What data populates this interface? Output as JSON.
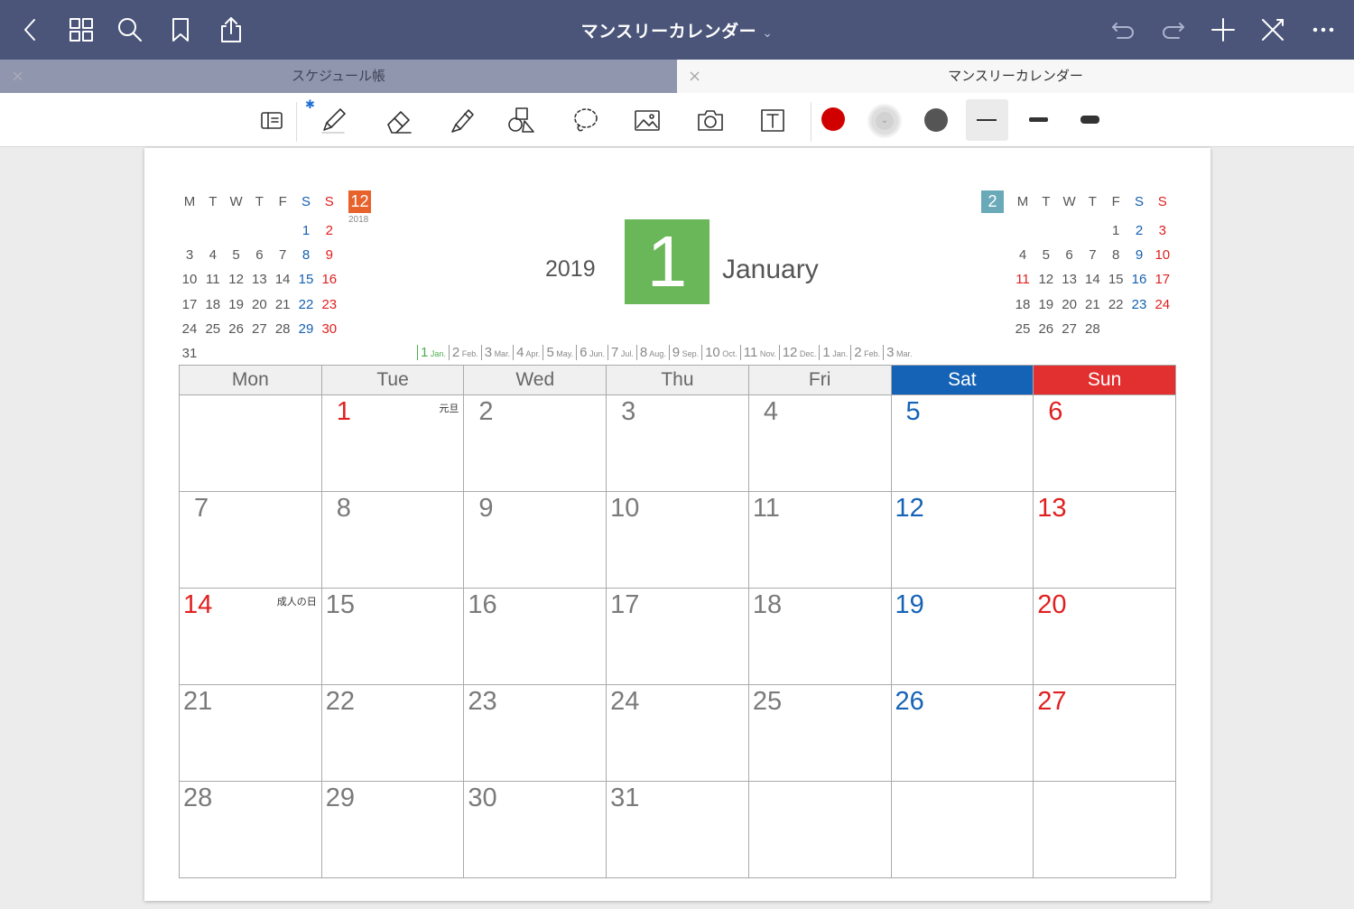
{
  "app": {
    "document_title": "マンスリーカレンダー",
    "title_chevron": "⌄"
  },
  "tabs": [
    {
      "label": "スケジュール帳",
      "close": "×"
    },
    {
      "label": "マンスリーカレンダー",
      "close": "×"
    }
  ],
  "toolbar": {
    "pen_color": "#cc0000",
    "selected_color": "#dcdcdc",
    "gray_color": "#555555",
    "bluetooth": "✱"
  },
  "calendar": {
    "year": "2019",
    "month_number": "1",
    "month_name": "January",
    "weekdays": [
      "Mon",
      "Tue",
      "Wed",
      "Thu",
      "Fri",
      "Sat",
      "Sun"
    ],
    "weeks": [
      [
        {
          "d": "",
          "h": ""
        },
        {
          "d": "1",
          "h": "元旦",
          "sun": true
        },
        {
          "d": "2",
          "h": ""
        },
        {
          "d": "3",
          "h": ""
        },
        {
          "d": "4",
          "h": ""
        },
        {
          "d": "5",
          "h": ""
        },
        {
          "d": "6",
          "h": ""
        }
      ],
      [
        {
          "d": "7",
          "h": ""
        },
        {
          "d": "8",
          "h": ""
        },
        {
          "d": "9",
          "h": ""
        },
        {
          "d": "10",
          "h": ""
        },
        {
          "d": "11",
          "h": ""
        },
        {
          "d": "12",
          "h": ""
        },
        {
          "d": "13",
          "h": ""
        }
      ],
      [
        {
          "d": "14",
          "h": "成人の日",
          "sun": true
        },
        {
          "d": "15",
          "h": ""
        },
        {
          "d": "16",
          "h": ""
        },
        {
          "d": "17",
          "h": ""
        },
        {
          "d": "18",
          "h": ""
        },
        {
          "d": "19",
          "h": ""
        },
        {
          "d": "20",
          "h": ""
        }
      ],
      [
        {
          "d": "21",
          "h": ""
        },
        {
          "d": "22",
          "h": ""
        },
        {
          "d": "23",
          "h": ""
        },
        {
          "d": "24",
          "h": ""
        },
        {
          "d": "25",
          "h": ""
        },
        {
          "d": "26",
          "h": ""
        },
        {
          "d": "27",
          "h": ""
        }
      ],
      [
        {
          "d": "28",
          "h": ""
        },
        {
          "d": "29",
          "h": ""
        },
        {
          "d": "30",
          "h": ""
        },
        {
          "d": "31",
          "h": ""
        },
        {
          "d": "",
          "h": ""
        },
        {
          "d": "",
          "h": ""
        },
        {
          "d": "",
          "h": ""
        }
      ]
    ],
    "month_nav": [
      {
        "n": "1",
        "abbr": "Jan."
      },
      {
        "n": "2",
        "abbr": "Feb."
      },
      {
        "n": "3",
        "abbr": "Mar."
      },
      {
        "n": "4",
        "abbr": "Apr."
      },
      {
        "n": "5",
        "abbr": "May."
      },
      {
        "n": "6",
        "abbr": "Jun."
      },
      {
        "n": "7",
        "abbr": "Jul."
      },
      {
        "n": "8",
        "abbr": "Aug."
      },
      {
        "n": "9",
        "abbr": "Sep."
      },
      {
        "n": "10",
        "abbr": "Oct."
      },
      {
        "n": "11",
        "abbr": "Nov."
      },
      {
        "n": "12",
        "abbr": "Dec."
      },
      {
        "n": "1",
        "abbr": "Jan."
      },
      {
        "n": "2",
        "abbr": "Feb."
      },
      {
        "n": "3",
        "abbr": "Mar."
      }
    ]
  },
  "mini_prev": {
    "month": "12",
    "year": "2018",
    "badge_color": "#e8622c",
    "weekday_letters": [
      "M",
      "T",
      "W",
      "T",
      "F",
      "S",
      "S"
    ],
    "rows": [
      [
        "",
        "",
        "",
        "",
        "",
        "1",
        "2"
      ],
      [
        "3",
        "4",
        "5",
        "6",
        "7",
        "8",
        "9"
      ],
      [
        "10",
        "11",
        "12",
        "13",
        "14",
        "15",
        "16"
      ],
      [
        "17",
        "18",
        "19",
        "20",
        "21",
        "22",
        "23"
      ],
      [
        "24",
        "25",
        "26",
        "27",
        "28",
        "29",
        "30"
      ],
      [
        "31",
        "",
        "",
        "",
        "",
        "",
        ""
      ]
    ]
  },
  "mini_next": {
    "month": "2",
    "badge_color": "#6aaab8",
    "weekday_letters": [
      "M",
      "T",
      "W",
      "T",
      "F",
      "S",
      "S"
    ],
    "rows": [
      [
        "",
        "",
        "",
        "",
        "1",
        "2",
        "3"
      ],
      [
        "4",
        "5",
        "6",
        "7",
        "8",
        "9",
        "10"
      ],
      [
        "11",
        "12",
        "13",
        "14",
        "15",
        "16",
        "17"
      ],
      [
        "18",
        "19",
        "20",
        "21",
        "22",
        "23",
        "24"
      ],
      [
        "25",
        "26",
        "27",
        "28",
        "",
        "",
        ""
      ]
    ],
    "holiday_dates": [
      "11"
    ]
  }
}
